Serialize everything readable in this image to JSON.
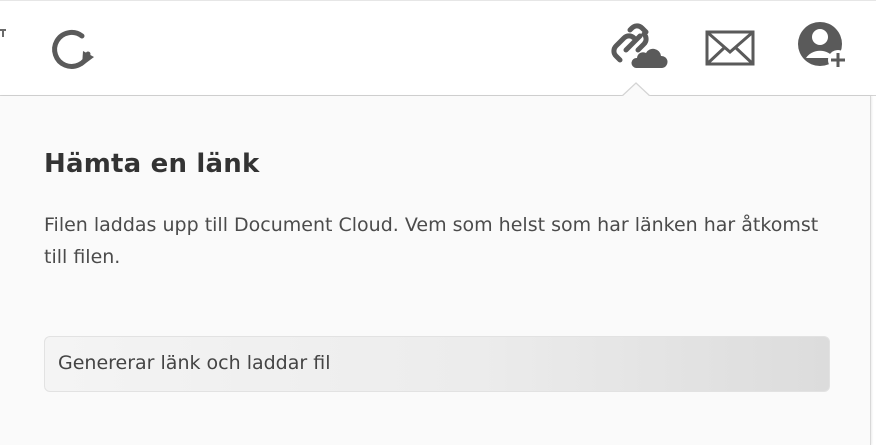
{
  "toolbar": {
    "icons": {
      "refresh": "refresh-icon",
      "link_cloud": "link-cloud-icon",
      "mail": "mail-icon",
      "add_user": "add-user-icon"
    },
    "icon_color": "#555555"
  },
  "panel": {
    "title": "Hämta en länk",
    "description": "Filen laddas upp till Document Cloud. Vem som helst som har länken har åtkomst till filen.",
    "status": "Genererar länk och laddar fil"
  }
}
